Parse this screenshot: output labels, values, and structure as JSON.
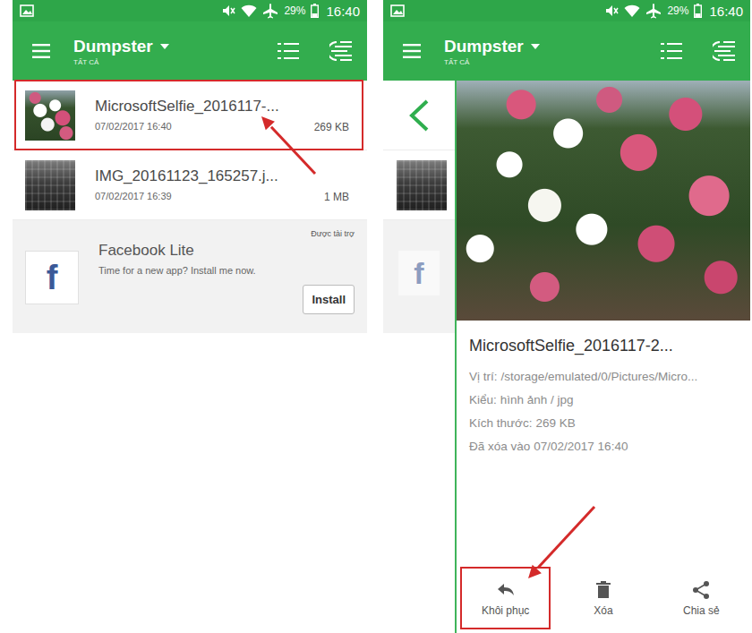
{
  "list_screen": {
    "status_bar": {
      "battery": "29%",
      "time": "16:40"
    },
    "app_bar": {
      "title": "Dumpster",
      "subtitle": "TẤT CẢ"
    },
    "list": [
      {
        "name": "MicrosoftSelfie_2016117-...",
        "date": "07/02/2017 16:40",
        "size": "269 KB",
        "highlighted": true
      },
      {
        "name": "IMG_20161123_165257.j...",
        "date": "07/02/2017 16:39",
        "size": "1 MB",
        "highlighted": false
      }
    ],
    "ad": {
      "logo": "f",
      "title": "Facebook Lite",
      "text": "Time for a new app? Install me now.",
      "sponsored": "Được tài trợ",
      "button": "Install"
    }
  },
  "detail_screen": {
    "status_bar": {
      "battery": "29%",
      "time": "16:40"
    },
    "app_bar": {
      "title": "Dumpster",
      "subtitle": "TẤT CẢ"
    },
    "strip": {
      "ad_logo": "f"
    },
    "detail": {
      "name": "MicrosoftSelfie_2016117-2...",
      "fields": [
        {
          "label": "Vị trí:",
          "value": "/storage/emulated/0/Pictures/Micro..."
        },
        {
          "label": "Kiểu:",
          "value": "hình ảnh / jpg"
        },
        {
          "label": "Kích thước:",
          "value": "269 KB"
        },
        {
          "label": "Đã xóa vào",
          "value": "07/02/2017 16:40"
        }
      ]
    },
    "actions": [
      {
        "label": "Khôi phục",
        "highlighted": true
      },
      {
        "label": "Xóa",
        "highlighted": false
      },
      {
        "label": "Chia sẻ",
        "highlighted": false
      }
    ]
  }
}
